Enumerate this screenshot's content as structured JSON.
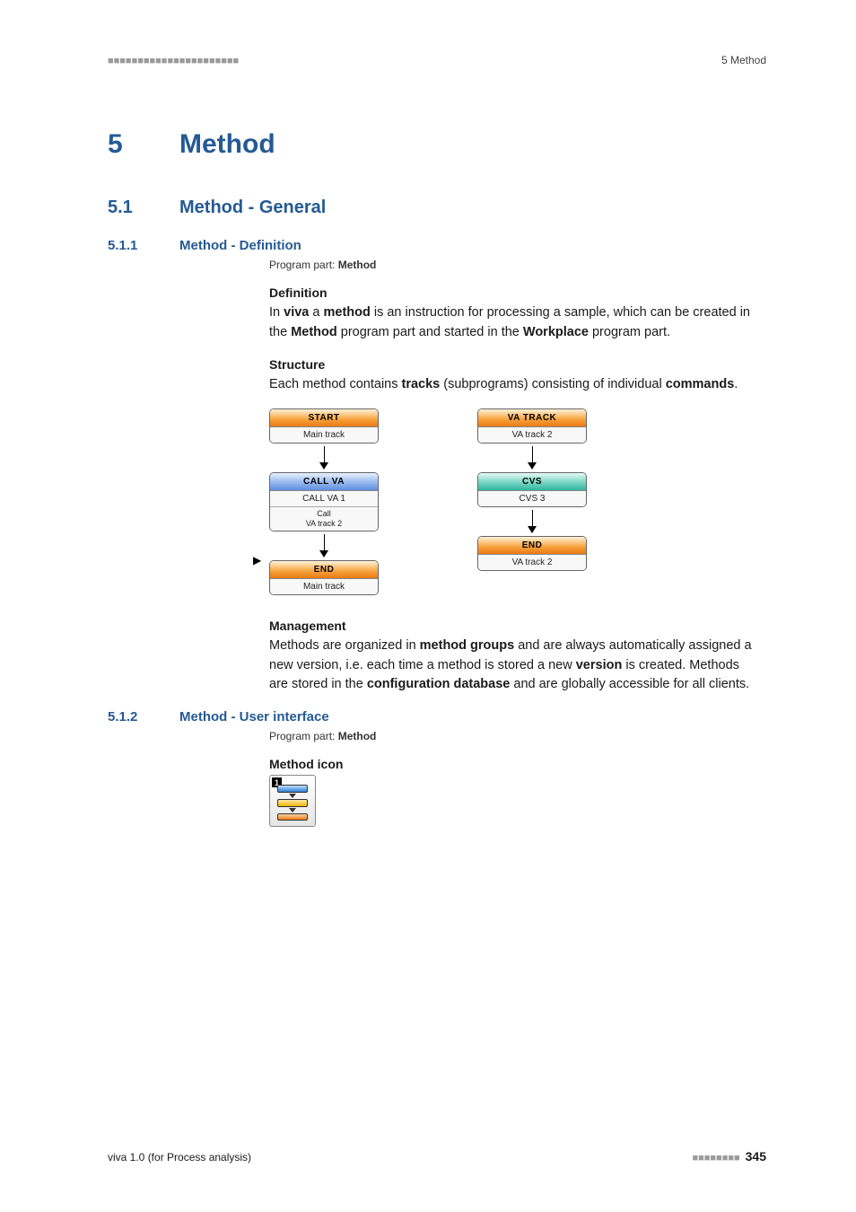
{
  "header": {
    "dashes": "■■■■■■■■■■■■■■■■■■■■■■",
    "right": "5 Method"
  },
  "chapter": {
    "num": "5",
    "title": "Method"
  },
  "section": {
    "num": "5.1",
    "title": "Method - General"
  },
  "sub1": {
    "num": "5.1.1",
    "title": "Method - Definition",
    "program_part_label": "Program part: ",
    "program_part_value": "Method",
    "h_def": "Definition",
    "p_def_1": "In ",
    "p_def_viva": "viva",
    "p_def_2": " a ",
    "p_def_method": "method",
    "p_def_3": " is an instruction for processing a sample, which can be created in the ",
    "p_def_Method": "Method",
    "p_def_4": " program part and started in the ",
    "p_def_Workplace": "Workplace",
    "p_def_5": " program part.",
    "h_struct": "Structure",
    "p_struct_1": "Each method contains ",
    "p_struct_tracks": "tracks",
    "p_struct_2": " (subprograms) consisting of individual ",
    "p_struct_commands": "commands",
    "p_struct_3": ".",
    "h_mgmt": "Management",
    "p_mgmt_1": "Methods are organized in ",
    "p_mgmt_groups": "method groups",
    "p_mgmt_2": " and are always automatically assigned a new version, i.e. each time a method is stored a new ",
    "p_mgmt_version": "version",
    "p_mgmt_3": " is created. Methods are stored in the ",
    "p_mgmt_db": "configuration database",
    "p_mgmt_4": " and are globally accessible for all clients."
  },
  "diagram": {
    "left": {
      "start_head": "START",
      "start_sub": "Main track",
      "call_head": "CALL VA",
      "call_sub": "CALL VA 1",
      "call_extra1": "Call",
      "call_extra2": "VA track 2",
      "end_head": "END",
      "end_sub": "Main track",
      "marker": "▶"
    },
    "right": {
      "vatrack_head": "VA TRACK",
      "vatrack_sub": "VA track 2",
      "cvs_head": "CVS",
      "cvs_sub": "CVS 3",
      "end_head": "END",
      "end_sub": "VA track 2"
    }
  },
  "sub2": {
    "num": "5.1.2",
    "title": "Method - User interface",
    "program_part_label": "Program part: ",
    "program_part_value": "Method",
    "h_icon": "Method icon",
    "icon_tag": "1"
  },
  "footer": {
    "left": "viva 1.0 (for Process analysis)",
    "dashes": "■■■■■■■■",
    "page": "345"
  }
}
